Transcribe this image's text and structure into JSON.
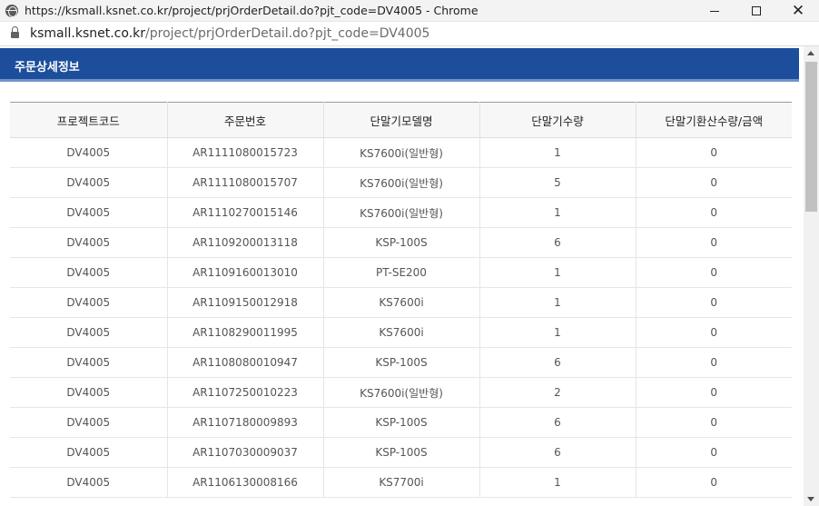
{
  "window": {
    "title": "https://ksmall.ksnet.co.kr/project/prjOrderDetail.do?pjt_code=DV4005 - Chrome",
    "controls": {
      "minimize": "minimize",
      "maximize": "maximize",
      "close": "close"
    }
  },
  "addressbar": {
    "host": "ksmall.ksnet.co.kr",
    "path": "/project/prjOrderDetail.do?pjt_code=DV4005"
  },
  "page": {
    "header_title": "주문상세정보"
  },
  "table": {
    "columns": [
      "프로젝트코드",
      "주문번호",
      "단말기모델명",
      "단말기수량",
      "단말기환산수량/금액"
    ],
    "rows": [
      [
        "DV4005",
        "AR1111080015723",
        "KS7600i(일반형)",
        "1",
        "0"
      ],
      [
        "DV4005",
        "AR1111080015707",
        "KS7600i(일반형)",
        "5",
        "0"
      ],
      [
        "DV4005",
        "AR1110270015146",
        "KS7600i(일반형)",
        "1",
        "0"
      ],
      [
        "DV4005",
        "AR1109200013118",
        "KSP-100S",
        "6",
        "0"
      ],
      [
        "DV4005",
        "AR1109160013010",
        "PT-SE200",
        "1",
        "0"
      ],
      [
        "DV4005",
        "AR1109150012918",
        "KS7600i",
        "1",
        "0"
      ],
      [
        "DV4005",
        "AR1108290011995",
        "KS7600i",
        "1",
        "0"
      ],
      [
        "DV4005",
        "AR1108080010947",
        "KSP-100S",
        "6",
        "0"
      ],
      [
        "DV4005",
        "AR1107250010223",
        "KS7600i(일반형)",
        "2",
        "0"
      ],
      [
        "DV4005",
        "AR1107180009893",
        "KSP-100S",
        "6",
        "0"
      ],
      [
        "DV4005",
        "AR1107030009037",
        "KSP-100S",
        "6",
        "0"
      ],
      [
        "DV4005",
        "AR1106130008166",
        "KS7700i",
        "1",
        "0"
      ]
    ]
  },
  "colors": {
    "header_bg": "#1c4e9c",
    "header_border": "#6f94c9"
  },
  "icons": {
    "site": "globe-icon",
    "secure": "lock-icon"
  }
}
